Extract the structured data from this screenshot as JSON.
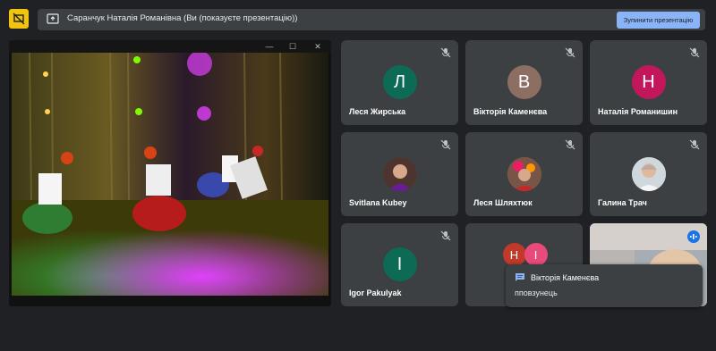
{
  "header": {
    "presenting_text": "Саранчук Наталія Романівна (Ви (показуєте презентацію))",
    "stop_button_label": "Зупинити презентацію"
  },
  "colors": {
    "background": "#202124",
    "tile": "#3c4043",
    "accent": "#8ab4f8",
    "logo": "#f1c40f"
  },
  "share_window": {
    "controls": [
      "—",
      "☐",
      "✕"
    ]
  },
  "participants": [
    {
      "name": "Леся Жирська",
      "initial": "Л",
      "color": "#0d6b55",
      "muted": true
    },
    {
      "name": "Вікторія Каменєва",
      "initial": "В",
      "color": "#8d6e63",
      "muted": true
    },
    {
      "name": "Наталія Романишин",
      "initial": "Н",
      "color": "#c2185b",
      "muted": true
    },
    {
      "name": "Svitlana Kubey",
      "initial": "",
      "color": "",
      "muted": true
    },
    {
      "name": "Леся Шляхтюк",
      "initial": "",
      "color": "",
      "muted": true
    },
    {
      "name": "Галина Трач",
      "initial": "",
      "color": "",
      "muted": true
    },
    {
      "name": "Igor Pakulyak",
      "initial": "І",
      "color": "#0d6b55",
      "muted": true
    },
    {
      "name": "",
      "initial": "",
      "color": "",
      "muted": false
    },
    {
      "name": "",
      "initial": "",
      "color": "",
      "muted": false
    }
  ],
  "group_tile": {
    "initials": [
      "Н",
      "І"
    ],
    "colors": [
      "#c0392b",
      "#e84a7a"
    ]
  },
  "chat_toast": {
    "sender": "Вікторія Каменєва",
    "message": "пповзунець"
  }
}
